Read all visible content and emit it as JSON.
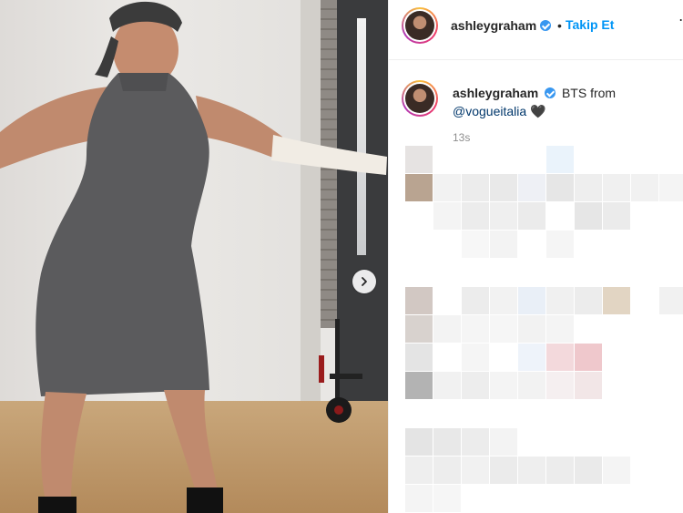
{
  "post": {
    "image_alt": "",
    "next_icon": "chevron-right-icon"
  },
  "header": {
    "username": "ashleygraham",
    "separator": "•",
    "follow_label": "Takip Et",
    "more_icon": "more-options-icon"
  },
  "caption": {
    "username": "ashleygraham",
    "text": "BTS from",
    "mention": "@vogueitalia",
    "emoji": "🖤"
  },
  "timestamp": "13s",
  "colors": {
    "accent": "#0095f6",
    "verified": "#3897f0",
    "mention": "#00376b",
    "text": "#262626",
    "muted": "#8e8e8e"
  }
}
